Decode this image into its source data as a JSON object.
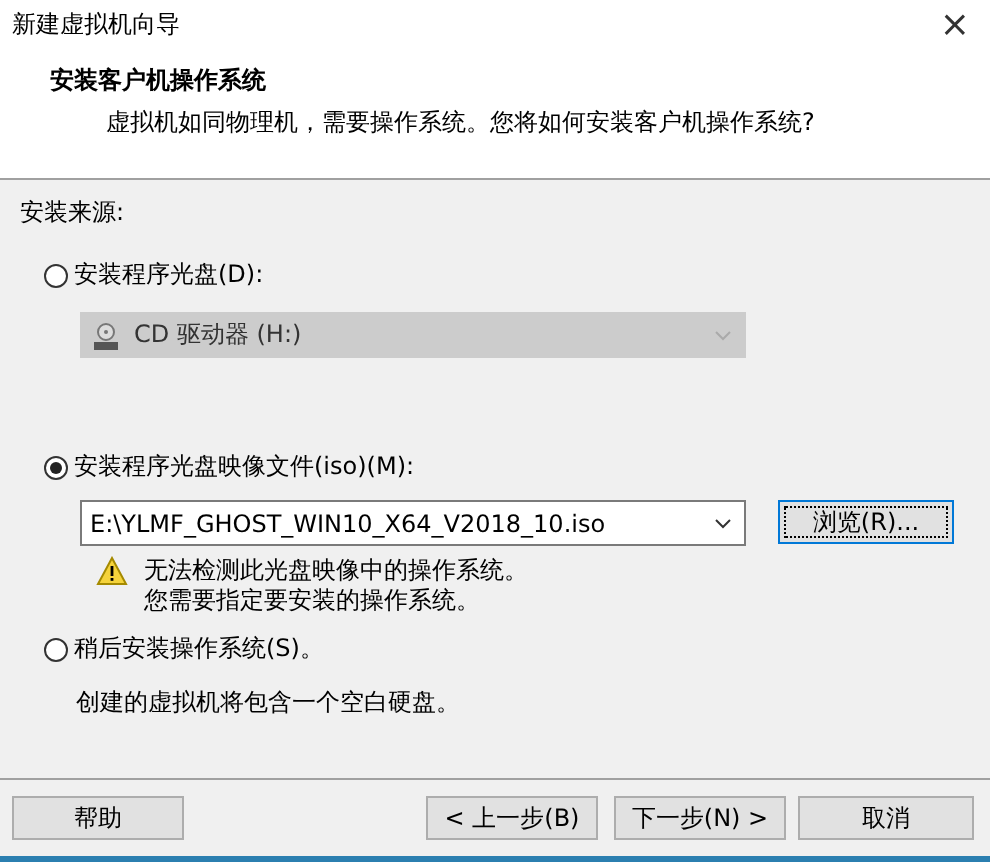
{
  "window": {
    "title": "新建虚拟机向导",
    "close": "×"
  },
  "header": {
    "title": "安装客户机操作系统",
    "subtitle": "虚拟机如同物理机，需要操作系统。您将如何安装客户机操作系统?"
  },
  "source_label": "安装来源:",
  "options": [
    {
      "kind": "drive",
      "label": "安装程序光盘(D):",
      "selected": false,
      "value": "CD 驱动器 (H:)",
      "disabled": true
    },
    {
      "kind": "iso",
      "label": "安装程序光盘映像文件(iso)(M):",
      "selected": true,
      "value": "E:\\YLMF_GHOST_WIN10_X64_V2018_10.iso",
      "browse": "浏览(R)...",
      "warning": [
        "无法检测此光盘映像中的操作系统。",
        "您需要指定要安装的操作系统。"
      ]
    },
    {
      "kind": "later",
      "label": "稍后安装操作系统(S)。",
      "selected": false,
      "note": "创建的虚拟机将包含一个空白硬盘。"
    }
  ],
  "buttons": {
    "help": "帮助",
    "back": "< 上一步(B)",
    "next": "下一步(N) >",
    "cancel": "取消"
  }
}
